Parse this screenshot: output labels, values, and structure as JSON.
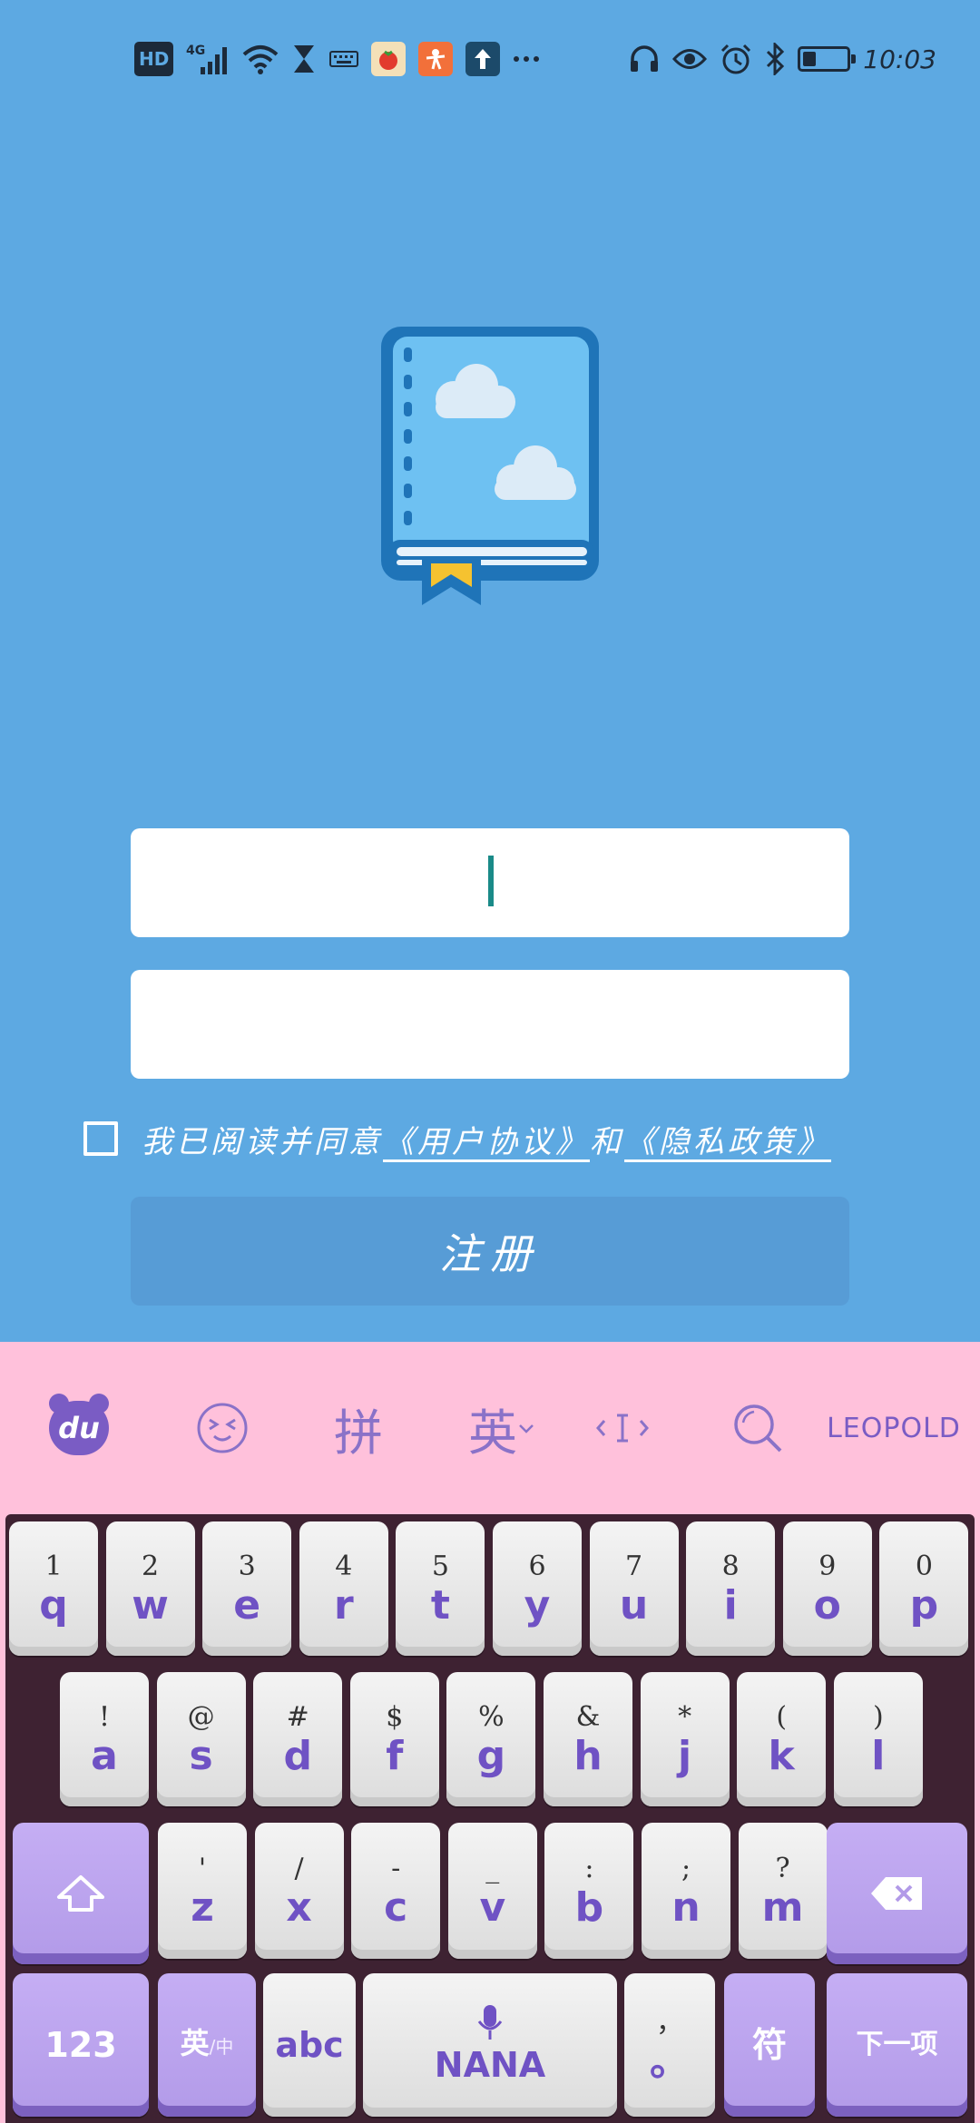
{
  "status_bar": {
    "left_icons": [
      "hd-icon",
      "signal-4g-icon",
      "wifi-icon",
      "hourglass-icon",
      "keyboard-icon",
      "tomato-app-icon",
      "person-app-icon",
      "upload-app-icon",
      "more-icon"
    ],
    "hd_label": "HD",
    "network_label": "4G",
    "right_icons": [
      "headphones-icon",
      "eye-icon",
      "alarm-icon",
      "bluetooth-icon",
      "battery-icon"
    ],
    "battery_level": 0.3,
    "time": "10:03"
  },
  "form": {
    "username_value": "",
    "password_value": "",
    "agree_prefix": "我已阅读并同意",
    "user_agreement": "《用户协议》",
    "and": "和",
    "privacy_policy": "《隐私政策》",
    "agreed": false,
    "register_label": "注册"
  },
  "keyboard": {
    "toolbar": {
      "du_label": "du",
      "pinyin_label": "拼",
      "english_label": "英",
      "brand_label": "LEOPOLD"
    },
    "row1": [
      {
        "top": "1",
        "key": "q"
      },
      {
        "top": "2",
        "key": "w"
      },
      {
        "top": "3",
        "key": "e"
      },
      {
        "top": "4",
        "key": "r"
      },
      {
        "top": "5",
        "key": "t"
      },
      {
        "top": "6",
        "key": "y"
      },
      {
        "top": "7",
        "key": "u"
      },
      {
        "top": "8",
        "key": "i"
      },
      {
        "top": "9",
        "key": "o"
      },
      {
        "top": "0",
        "key": "p"
      }
    ],
    "row2": [
      {
        "top": "!",
        "key": "a"
      },
      {
        "top": "@",
        "key": "s"
      },
      {
        "top": "#",
        "key": "d"
      },
      {
        "top": "$",
        "key": "f"
      },
      {
        "top": "%",
        "key": "g"
      },
      {
        "top": "&",
        "key": "h"
      },
      {
        "top": "*",
        "key": "j"
      },
      {
        "top": "(",
        "key": "k"
      },
      {
        "top": ")",
        "key": "l"
      }
    ],
    "row3": [
      {
        "top": "'",
        "key": "z"
      },
      {
        "top": "/",
        "key": "x"
      },
      {
        "top": "-",
        "key": "c"
      },
      {
        "top": "_",
        "key": "v"
      },
      {
        "top": ":",
        "key": "b"
      },
      {
        "top": ";",
        "key": "n"
      },
      {
        "top": "?",
        "key": "m"
      }
    ],
    "row4": {
      "num_label": "123",
      "lang_label": "英",
      "lang_sub": "/中",
      "abc_label": "abc",
      "space_label": "NANA",
      "punct_top": "，",
      "punct_bottom": "。",
      "symbol_label": "符",
      "next_label": "下一项"
    }
  }
}
